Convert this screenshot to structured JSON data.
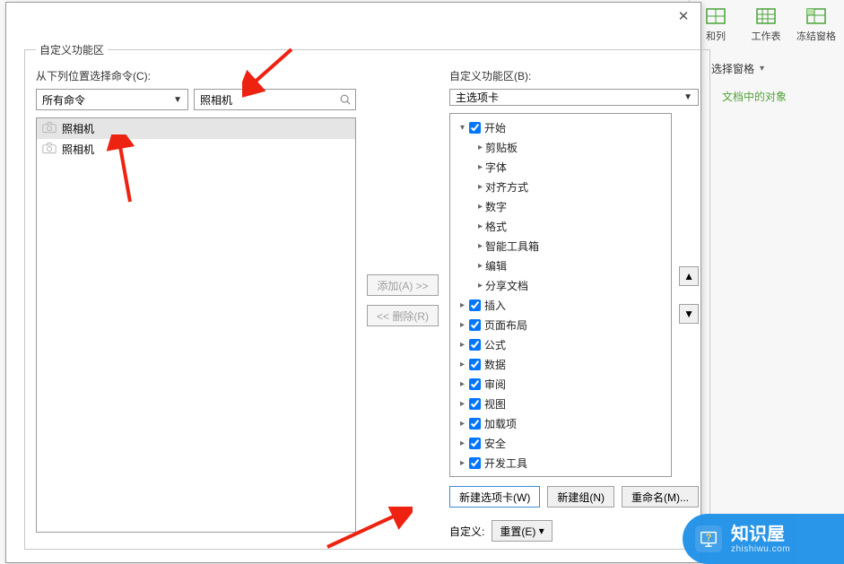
{
  "bg_ribbon": [
    {
      "name": "row-col-icon",
      "label": "和列"
    },
    {
      "name": "worksheet-icon",
      "label": "工作表"
    },
    {
      "name": "freeze-pane-icon",
      "label": "冻结窗格"
    }
  ],
  "bg_side": {
    "header": "选择窗格",
    "item": "文档中的对象"
  },
  "dialog": {
    "close": "✕",
    "fieldset_legend": "自定义功能区",
    "left_label": "从下列位置选择命令(C):",
    "combo_left": "所有命令",
    "search_value": "照相机",
    "list": [
      {
        "label": "照相机",
        "selected": true
      },
      {
        "label": "照相机",
        "selected": false
      }
    ],
    "btn_add": "添加(A) >>",
    "btn_remove": "<< 删除(R)",
    "right_label": "自定义功能区(B):",
    "combo_right": "主选项卡",
    "tree": [
      {
        "ind": 1,
        "exp": "▾",
        "chk": true,
        "label": "开始"
      },
      {
        "ind": 2,
        "exp": "▸",
        "chk": null,
        "label": "剪贴板"
      },
      {
        "ind": 2,
        "exp": "▸",
        "chk": null,
        "label": "字体"
      },
      {
        "ind": 2,
        "exp": "▸",
        "chk": null,
        "label": "对齐方式"
      },
      {
        "ind": 2,
        "exp": "▸",
        "chk": null,
        "label": "数字"
      },
      {
        "ind": 2,
        "exp": "▸",
        "chk": null,
        "label": "格式"
      },
      {
        "ind": 2,
        "exp": "▸",
        "chk": null,
        "label": "智能工具箱"
      },
      {
        "ind": 2,
        "exp": "▸",
        "chk": null,
        "label": "编辑"
      },
      {
        "ind": 2,
        "exp": "▸",
        "chk": null,
        "label": "分享文档"
      },
      {
        "ind": 1,
        "exp": "▸",
        "chk": true,
        "label": "插入"
      },
      {
        "ind": 1,
        "exp": "▸",
        "chk": true,
        "label": "页面布局"
      },
      {
        "ind": 1,
        "exp": "▸",
        "chk": true,
        "label": "公式"
      },
      {
        "ind": 1,
        "exp": "▸",
        "chk": true,
        "label": "数据"
      },
      {
        "ind": 1,
        "exp": "▸",
        "chk": true,
        "label": "审阅"
      },
      {
        "ind": 1,
        "exp": "▸",
        "chk": true,
        "label": "视图"
      },
      {
        "ind": 1,
        "exp": "▸",
        "chk": true,
        "label": "加载项"
      },
      {
        "ind": 1,
        "exp": "▸",
        "chk": true,
        "label": "安全"
      },
      {
        "ind": 1,
        "exp": "▸",
        "chk": true,
        "label": "开发工具"
      }
    ],
    "btn_up": "▲",
    "btn_down": "▼",
    "btn_new_tab": "新建选项卡(W)",
    "btn_new_group": "新建组(N)",
    "btn_rename": "重命名(M)...",
    "cust_label": "自定义:",
    "btn_reset": "重置(E)",
    "reset_arrow": "▾"
  },
  "watermark": {
    "big": "知识屋",
    "small": "zhishiwu.com"
  }
}
